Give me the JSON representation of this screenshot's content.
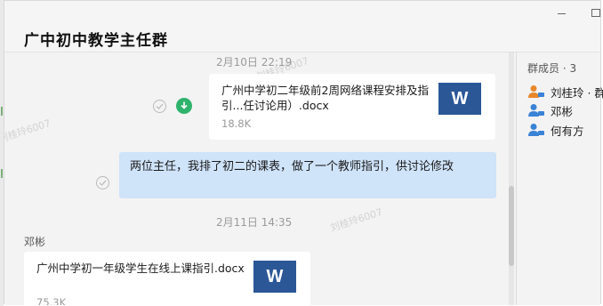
{
  "window": {
    "title": "广中初中教学主任群"
  },
  "watermark_text": "刘桂玲6007",
  "messages": {
    "ts1": "2月10日 22:19",
    "file1": {
      "name": "广州中学初二年级前2周网络课程安排及指引...任讨论用）.docx",
      "size": "18.8K",
      "icon_letter": "W"
    },
    "text1": "两位主任，我排了初二的课表，做了一个教师指引，供讨论修改",
    "ts2": "2月11日 14:35",
    "sender2": "邓彬",
    "file2": {
      "name": "广州中学初一年级学生在线上课指引.docx",
      "size": "75.3K",
      "icon_letter": "W"
    }
  },
  "members": {
    "header": "群成员 · 3",
    "list": [
      {
        "name": "刘桂玲 · 群",
        "icon": "owner-avatar-icon",
        "color": "#e8872a"
      },
      {
        "name": "邓彬",
        "icon": "member-avatar-icon",
        "color": "#3a82d6"
      },
      {
        "name": "何有方",
        "icon": "member-avatar-icon",
        "color": "#3a82d6"
      }
    ]
  },
  "colors": {
    "bubble": "#cfe3f9",
    "word_icon": "#2b5797",
    "download": "#2fb36c"
  }
}
